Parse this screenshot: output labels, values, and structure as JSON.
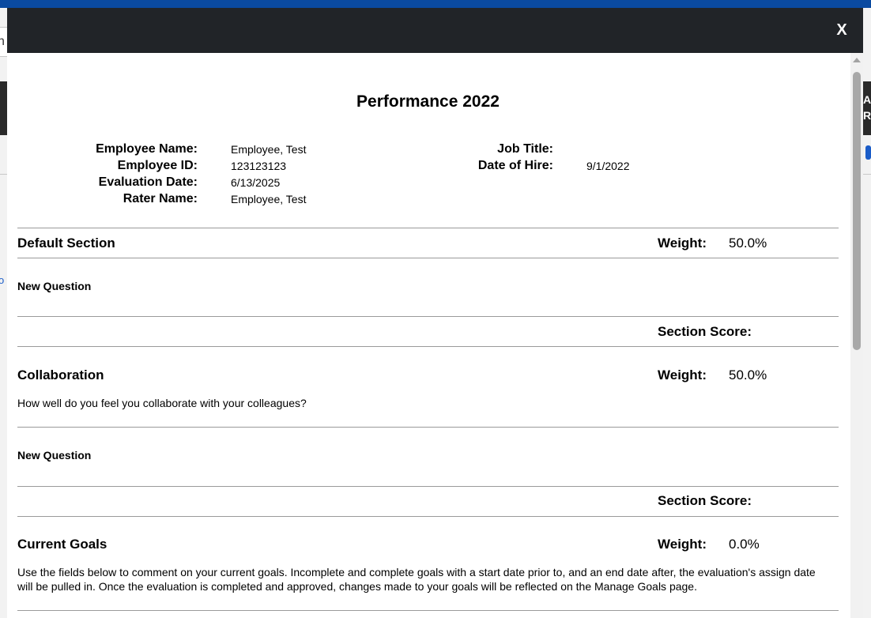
{
  "background": {
    "left_char": "n",
    "right_char1": "A",
    "right_char2": "R",
    "left_link": "o"
  },
  "modal": {
    "close_label": "X",
    "title": "Performance 2022",
    "employee_info": {
      "name_label": "Employee Name:",
      "name_value": "Employee, Test",
      "id_label": "Employee ID:",
      "id_value": "123123123",
      "eval_date_label": "Evaluation Date:",
      "eval_date_value": "6/13/2025",
      "rater_label": "Rater Name:",
      "rater_value": "Employee, Test",
      "job_title_label": "Job Title:",
      "job_title_value": "",
      "hire_date_label": "Date of Hire:",
      "hire_date_value": "9/1/2022"
    },
    "sections": {
      "default": {
        "title": "Default Section",
        "weight_label": "Weight:",
        "weight_value": "50.0%",
        "question": "New Question",
        "score_label": "Section Score:"
      },
      "collaboration": {
        "title": "Collaboration",
        "weight_label": "Weight:",
        "weight_value": "50.0%",
        "description": "How well do you feel you collaborate with your colleagues?",
        "question": "New Question",
        "score_label": "Section Score:"
      },
      "current_goals": {
        "title": "Current Goals",
        "weight_label": "Weight:",
        "weight_value": "0.0%",
        "description": "Use the fields below to comment on your current goals. Incomplete and complete goals with a start date prior to, and an end date after, the evaluation's assign date will be pulled in. Once the evaluation is completed and approved, changes made to your goals will be reflected on the Manage Goals page."
      }
    }
  },
  "colors": {
    "header_bg": "#212428",
    "top_bar": "#0a4aa0",
    "divider": "#9a9a9a"
  }
}
